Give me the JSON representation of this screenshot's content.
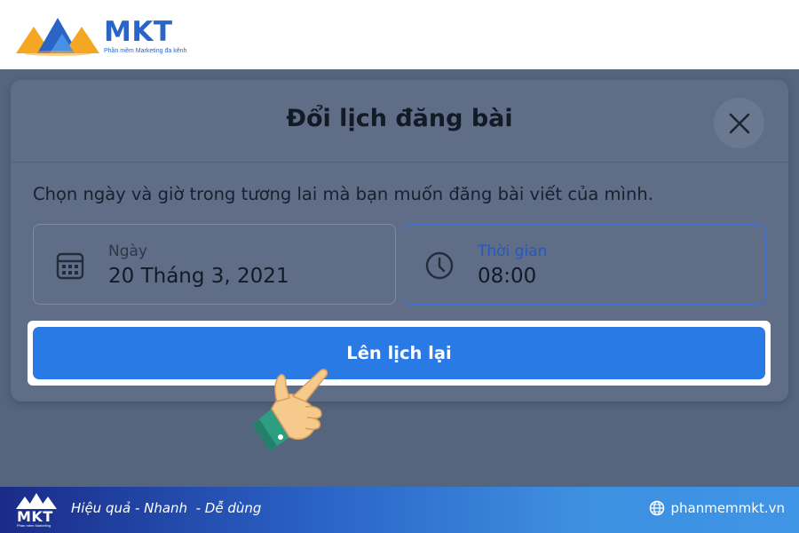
{
  "brand": {
    "name": "MKT",
    "tagline": "Phần mềm Marketing đa kênh",
    "colors": {
      "primary": "#2a64c6",
      "orange": "#f5a623"
    }
  },
  "dialog": {
    "title": "Đổi lịch đăng bài",
    "description": "Chọn ngày và giờ trong tương lai mà bạn muốn đăng bài viết của mình.",
    "close_icon": "close-icon",
    "date_field": {
      "label": "Ngày",
      "value": "20 Tháng 3, 2021",
      "icon": "calendar-icon"
    },
    "time_field": {
      "label": "Thời gian",
      "value": "08:00",
      "icon": "clock-icon"
    },
    "confirm_button": "Lên lịch lại",
    "colors": {
      "accent": "#2a7ae6",
      "active_border": "#3f6fcf"
    }
  },
  "footer": {
    "logo_text": "MKT",
    "logo_sub": "Phần mềm Marketing",
    "slogan": "Hiệu quả - Nhanh  - Dễ dùng",
    "website": "phanmemmkt.vn",
    "website_icon": "globe-icon"
  }
}
